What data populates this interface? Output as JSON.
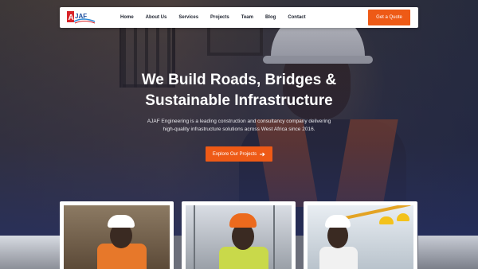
{
  "brand": {
    "logo_text": "AJAF",
    "colors": {
      "accent": "#ee5a16",
      "nav_text": "#1f2430",
      "white": "#ffffff"
    }
  },
  "nav": {
    "links": [
      "Home",
      "About Us",
      "Services",
      "Projects",
      "Team",
      "Blog",
      "Contact"
    ],
    "cta_label": "Get a Quote"
  },
  "hero": {
    "title_line1": "We Build Roads, Bridges &",
    "title_line2": "Sustainable Infrastructure",
    "subtitle_line1": "AJAF Engineering is a leading construction and consultancy company delivering",
    "subtitle_line2": "high-quality infrastructure solutions across West Africa since 2016.",
    "button_label": "Explore Our Projects",
    "button_icon": "arrow-right-icon"
  }
}
